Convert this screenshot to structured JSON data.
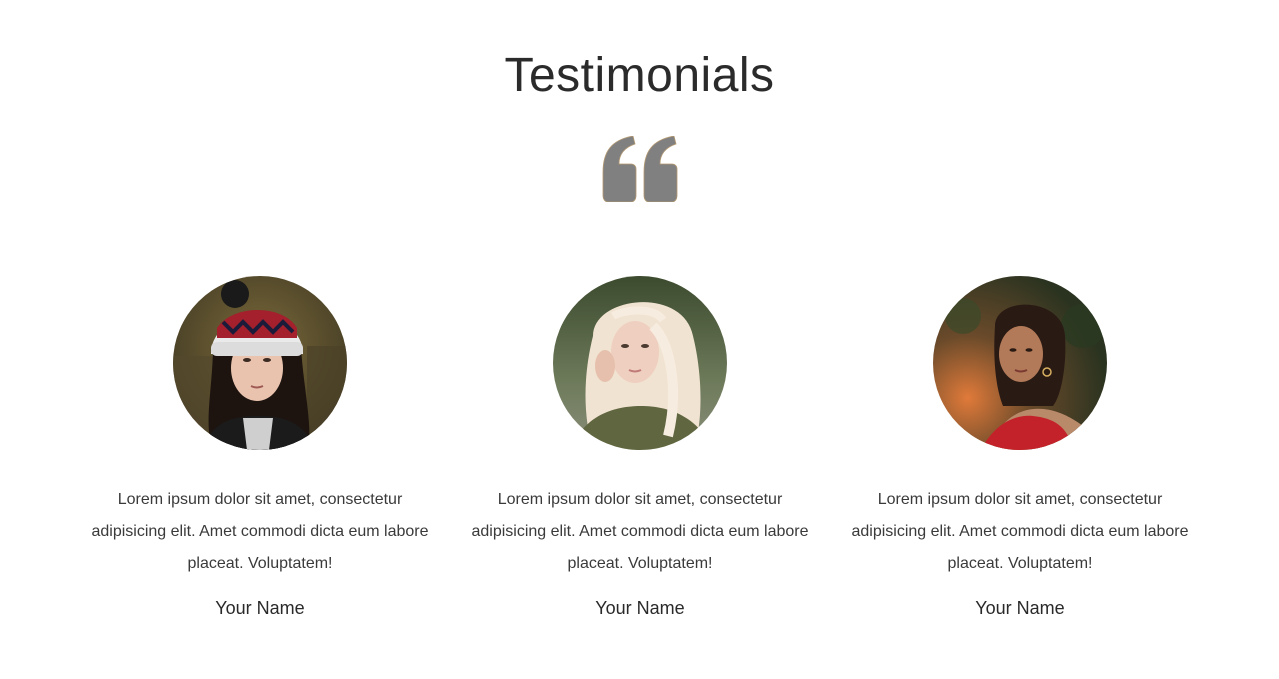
{
  "section": {
    "title": "Testimonials",
    "quote_icon": "quote-left-icon"
  },
  "testimonials": [
    {
      "avatar": "avatar-photo-woman-beanie",
      "text": "Lorem ipsum dolor sit amet, consectetur adipisicing elit. Amet commodi dicta eum labore placeat. Voluptatem!",
      "name": "Your Name"
    },
    {
      "avatar": "avatar-photo-woman-blonde",
      "text": "Lorem ipsum dolor sit amet, consectetur adipisicing elit. Amet commodi dicta eum labore placeat. Voluptatem!",
      "name": "Your Name"
    },
    {
      "avatar": "avatar-photo-woman-red-dress",
      "text": "Lorem ipsum dolor sit amet, consectetur adipisicing elit. Amet commodi dicta eum labore placeat. Voluptatem!",
      "name": "Your Name"
    }
  ],
  "colors": {
    "background": "#ffffff",
    "title": "#2b2b2b",
    "quote_icon": "#808080",
    "body_text": "#3a3a3a"
  }
}
